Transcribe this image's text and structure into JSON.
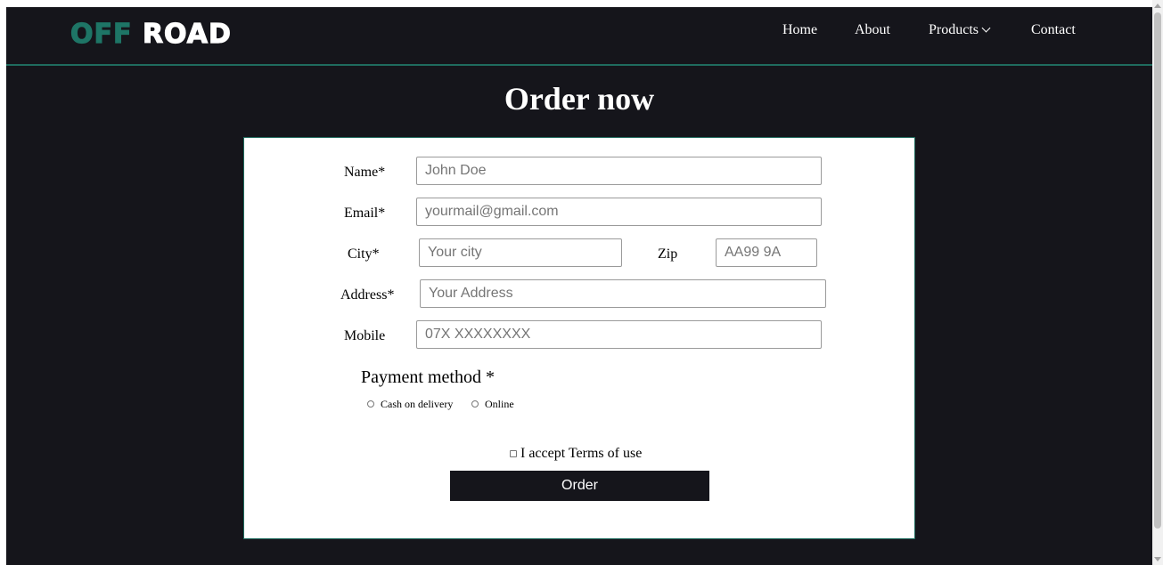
{
  "brand": {
    "logo_part1": "OFF",
    "logo_part2": "ROAD",
    "accent": "#1e7566",
    "background": "#15151b"
  },
  "nav": {
    "home": "Home",
    "about": "About",
    "products": "Products",
    "products_icon": "chevron-down-icon",
    "contact": "Contact"
  },
  "page": {
    "title": "Order now"
  },
  "form": {
    "name": {
      "label": "Name*",
      "placeholder": "John Doe",
      "value": ""
    },
    "email": {
      "label": "Email*",
      "placeholder": "yourmail@gmail.com",
      "value": ""
    },
    "city": {
      "label": "City*",
      "placeholder": "Your city",
      "value": ""
    },
    "zip": {
      "label": "Zip",
      "placeholder": "AA99 9A",
      "value": ""
    },
    "address": {
      "label": "Address*",
      "placeholder": "Your Address",
      "value": ""
    },
    "mobile": {
      "label": "Mobile",
      "placeholder": "07X XXXXXXXX",
      "value": ""
    },
    "payment": {
      "title": "Payment method *",
      "options": [
        "Cash on delivery",
        "Online"
      ],
      "selected": null
    },
    "terms": {
      "label": "I accept Terms of use",
      "checked": false
    },
    "submit_label": "Order"
  }
}
